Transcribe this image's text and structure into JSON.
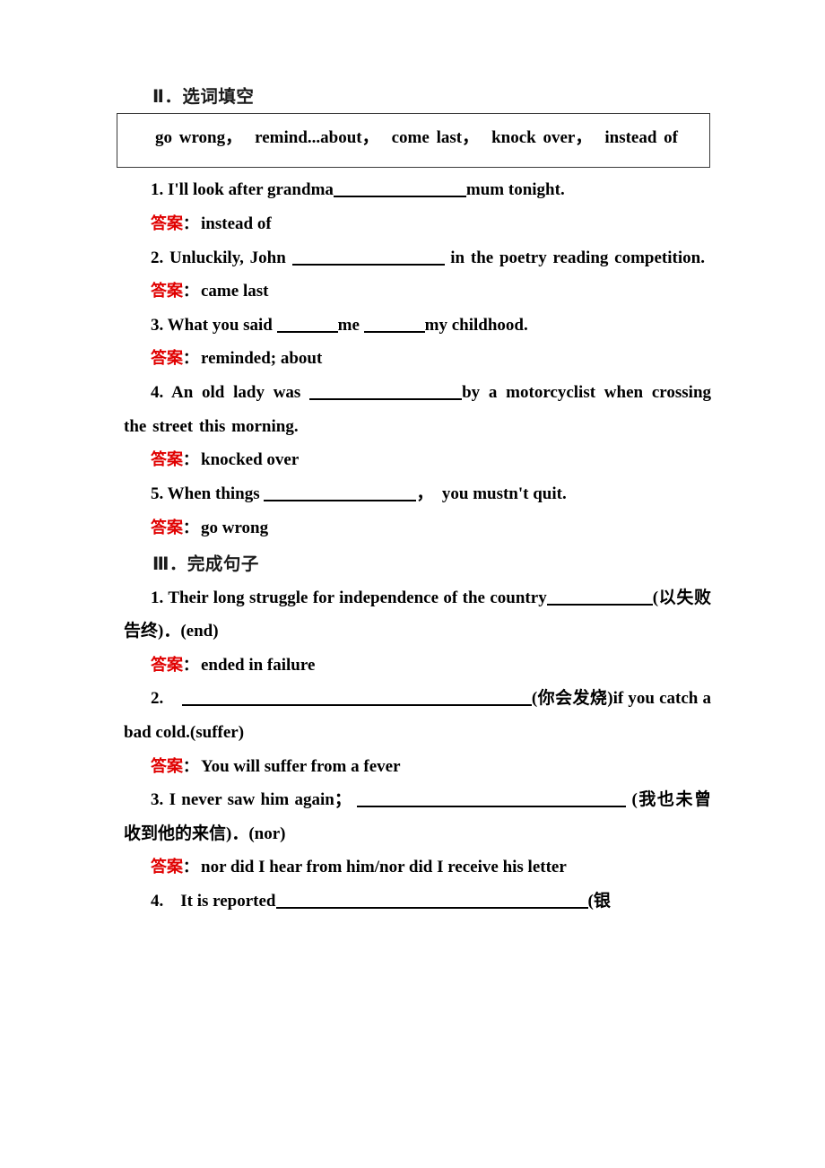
{
  "document": {
    "background_color": "#ffffff",
    "text_color": "#000000",
    "answer_label_color": "#e00000"
  },
  "section2": {
    "heading": "Ⅱ．选词填空",
    "word_bank": {
      "items": [
        "go wrong，",
        "remind...about，",
        "come last，",
        "knock over，",
        "instead of"
      ],
      "line1": "go wrong，　remind...about，　come last，　knock over，　instead",
      "line2": "of"
    },
    "questions": [
      {
        "number": "1.",
        "text_before": "I'll look after grandma",
        "text_after": "mum tonight.",
        "answer_label": "答案",
        "answer_colon": "：",
        "answer": "instead of"
      },
      {
        "number": "2.",
        "text_before": "Unluckily, John",
        "text_after": "in the poetry reading competition.",
        "answer_label": "答案",
        "answer_colon": "：",
        "answer": "came last"
      },
      {
        "number": "3.",
        "text_before": "What you said",
        "text_middle": "me",
        "text_after": "my childhood.",
        "answer_label": "答案",
        "answer_colon": "：",
        "answer": "reminded; about"
      },
      {
        "number": "4.",
        "text_before": "An old lady was",
        "text_after": "by a motorcyclist when crossing the street this morning.",
        "answer_label": "答案",
        "answer_colon": "：",
        "answer": "knocked over"
      },
      {
        "number": "5.",
        "text_before": "When things",
        "text_after": "，　you mustn't quit.",
        "answer_label": "答案",
        "answer_colon": "：",
        "answer": "go wrong"
      }
    ]
  },
  "section3": {
    "heading": "Ⅲ．完成句子",
    "questions": [
      {
        "number": "1.",
        "text_before": "Their long struggle for independence of the country",
        "text_after": "(以失败告终)．(end)",
        "answer_label": "答案",
        "answer_colon": "：",
        "answer": "ended in failure"
      },
      {
        "number": "2.",
        "text_before": "",
        "text_after": "(你会发烧)if you catch a bad cold.(suffer)",
        "answer_label": "答案",
        "answer_colon": "：",
        "answer": "You will suffer from a fever"
      },
      {
        "number": "3.",
        "text_before": "I never saw him again；",
        "text_after": "(我也未曾收到他的来信)．(nor)",
        "answer_label": "答案",
        "answer_colon": "：",
        "answer": "nor did I hear from him/nor did I receive his letter"
      },
      {
        "number": "4.",
        "text_before": "It is reported",
        "text_after": "(银",
        "answer_label": "",
        "answer_colon": "",
        "answer": ""
      }
    ]
  }
}
